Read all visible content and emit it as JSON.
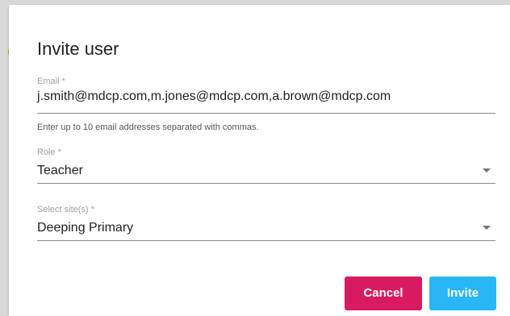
{
  "dialog": {
    "title": "Invite user",
    "email": {
      "label": "Email *",
      "value": "j.smith@mdcp.com,m.jones@mdcp.com,a.brown@mdcp.com",
      "hint": "Enter up to 10 email addresses separated with commas."
    },
    "role": {
      "label": "Role *",
      "value": "Teacher",
      "icon": "dropdown-arrow-icon"
    },
    "site": {
      "label": "Select site(s) *",
      "value": "Deeping Primary",
      "icon": "dropdown-arrow-icon"
    },
    "actions": {
      "cancel_label": "Cancel",
      "invite_label": "Invite"
    }
  },
  "colors": {
    "cancel": "#d81b60",
    "invite": "#29b6f6",
    "label": "#9e9e9e",
    "text": "#212121"
  }
}
